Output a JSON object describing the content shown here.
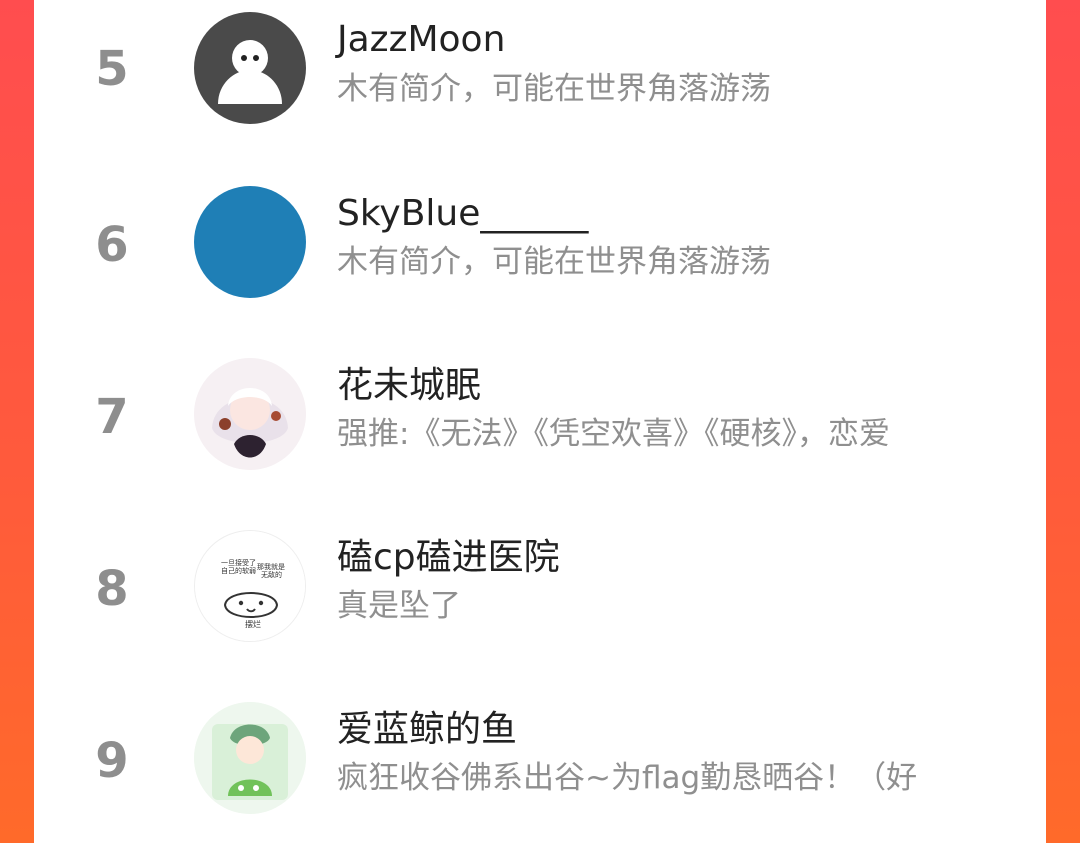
{
  "colors": {
    "background_gradient": [
      "#ff4d4f",
      "#ff6a2a"
    ],
    "panel": "#ffffff",
    "rank_text": "#8e8e8e",
    "name_text": "#222222",
    "desc_text": "#8f8f8f"
  },
  "ranking": {
    "items": [
      {
        "rank": "5",
        "name": "JazzMoon",
        "description": "木有简介，可能在世界角落游荡",
        "avatar": "ghost-avatar-icon"
      },
      {
        "rank": "6",
        "name": "SkyBlue______",
        "description": "木有简介，可能在世界角落游荡",
        "avatar": "blue-circle-avatar-icon"
      },
      {
        "rank": "7",
        "name": "花未城眠",
        "description": "强推:《无法》《凭空欢喜》《硬核》，恋爱",
        "avatar": "anime-girl-avatar-icon"
      },
      {
        "rank": "8",
        "name": "磕cp磕进医院",
        "description": "真是坠了",
        "avatar": "meme-sticker-avatar-icon"
      },
      {
        "rank": "9",
        "name": "爱蓝鲸的鱼",
        "description": "疯狂收谷佛系出谷~为flag勤恳晒谷！（好",
        "avatar": "green-anime-avatar-icon"
      }
    ],
    "avatar_texts": {
      "sticker_line1": "一旦接受了",
      "sticker_line2": "自己的软弱",
      "sticker_line3": "那我就是",
      "sticker_line4": "无敌的",
      "sticker_bottom": "摆烂"
    }
  }
}
